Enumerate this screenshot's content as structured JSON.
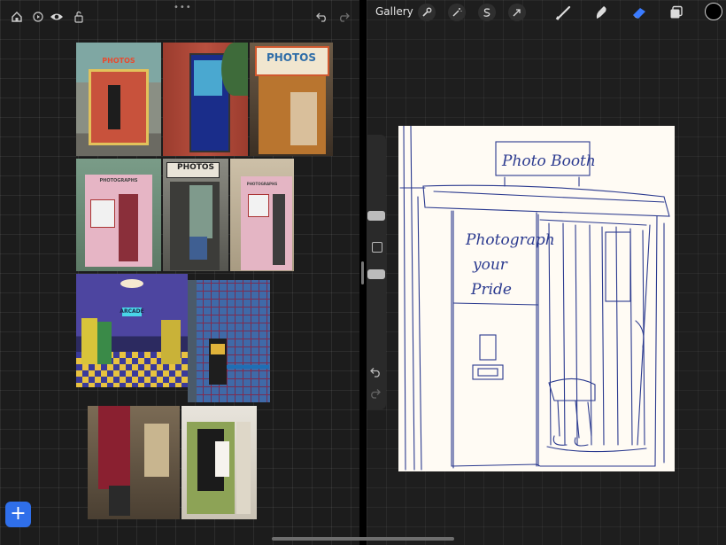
{
  "left_app": {
    "toolbar": {
      "home_icon": "house-icon",
      "play_icon": "play-icon",
      "view_icon": "eye-icon",
      "lock_icon": "unlock-icon",
      "more_icon": "ellipsis-icon",
      "undo_icon": "undo-icon",
      "redo_icon": "redo-icon"
    },
    "photos": [
      {
        "subject": "outdoor photo booth",
        "sign": "PHOTOS"
      },
      {
        "subject": "claw machine",
        "sign": ""
      },
      {
        "subject": "vintage photo booth",
        "sign": "PHOTOS"
      },
      {
        "subject": "pink photo booth",
        "sign": "PHOTOGRAPHS"
      },
      {
        "subject": "automat photo booth",
        "sign": "PHOTOS"
      },
      {
        "subject": "pink booth side",
        "sign": "PHOTOGRAPHS"
      },
      {
        "subject": "retro arcade room",
        "sign": "ARCADE"
      },
      {
        "subject": "checkered arcade room",
        "sign": ""
      },
      {
        "subject": "red curtain booth",
        "sign": ""
      },
      {
        "subject": "couple in booth",
        "sign": ""
      }
    ],
    "add_button_label": "+",
    "colors": {
      "accent": "#2f6fea"
    }
  },
  "right_app": {
    "toolbar": {
      "gallery_label": "Gallery",
      "tools_left": [
        "wrench-icon",
        "magic-wand-icon",
        "selection-s-icon",
        "arrow-cursor-icon"
      ],
      "tools_right": [
        "brush-icon",
        "smudge-icon",
        "eraser-icon",
        "layers-icon"
      ],
      "active_tool": "eraser-icon",
      "color": "#000000",
      "active_color": "#3a7bff"
    },
    "sidebar": {
      "brush_size": 0.7,
      "brush_opacity": 0.3,
      "modify_icon": "square-icon",
      "undo_icon": "undo-icon",
      "redo_icon": "redo-icon"
    },
    "sketch": {
      "sign_text": "Photo Booth",
      "panel_line_1": "Photograph",
      "panel_line_2": "your",
      "panel_line_3": "Pride",
      "ink_color": "#2b3a8f"
    }
  }
}
